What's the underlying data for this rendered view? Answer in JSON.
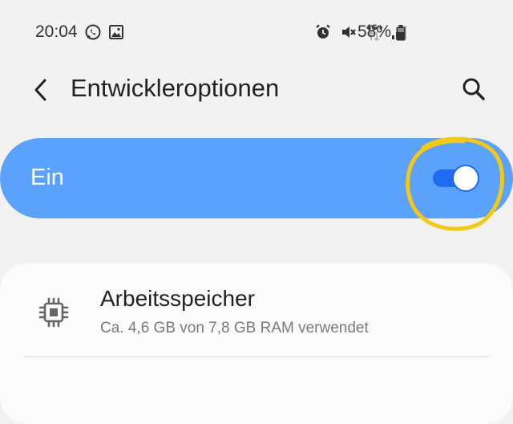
{
  "status_bar": {
    "time": "20:04",
    "left_icons": [
      "whatsapp-icon",
      "gallery-icon"
    ],
    "right_icons": [
      "alarm-icon",
      "mute-icon",
      "4g-icon",
      "signal-icon"
    ],
    "network_label": "4G+",
    "battery_percent": "58%"
  },
  "app_bar": {
    "title": "Entwickleroptionen",
    "back_icon": "chevron-left-icon",
    "search_icon": "search-icon"
  },
  "master_switch": {
    "label": "Ein",
    "state": true,
    "accent_color": "#1f6cf0",
    "bar_color": "#5aa2fb",
    "highlight_color": "#f2c918"
  },
  "settings": {
    "items": [
      {
        "title": "Arbeitsspeicher",
        "subtitle": "Ca. 4,6 GB von 7,8 GB RAM verwendet",
        "icon": "chip-icon"
      }
    ]
  }
}
